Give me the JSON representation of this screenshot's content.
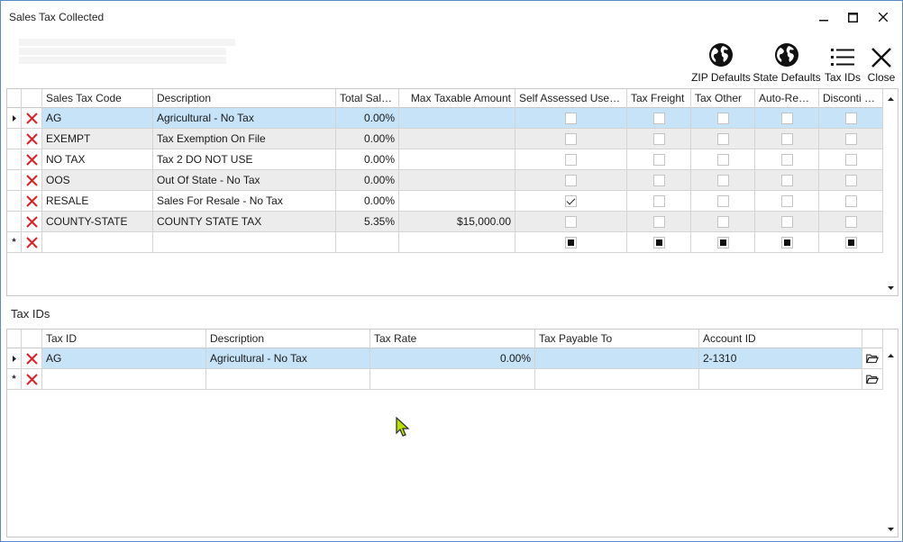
{
  "window": {
    "title": "Sales Tax Collected"
  },
  "toolbar": {
    "zip_defaults": "ZIP Defaults",
    "state_defaults": "State Defaults",
    "tax_ids": "Tax IDs",
    "close": "Close"
  },
  "grid1": {
    "headers": [
      "Sales Tax Code",
      "Description",
      "Total Sale...",
      "Max Taxable Amount",
      "Self Assessed Use Tax",
      "Tax Freight",
      "Tax Other",
      "Auto-Repl...",
      "Disconti n..."
    ],
    "rows": [
      {
        "code": "AG",
        "desc": "Agricultural - No Tax",
        "total": "0.00%",
        "max": "",
        "self": false
      },
      {
        "code": "EXEMPT",
        "desc": "Tax Exemption On File",
        "total": "0.00%",
        "max": "",
        "self": false
      },
      {
        "code": "NO TAX",
        "desc": "Tax 2 DO NOT USE",
        "total": "0.00%",
        "max": "",
        "self": false
      },
      {
        "code": "OOS",
        "desc": "Out Of State - No Tax",
        "total": "0.00%",
        "max": "",
        "self": false
      },
      {
        "code": "RESALE",
        "desc": "Sales For Resale - No Tax",
        "total": "0.00%",
        "max": "",
        "self": true
      },
      {
        "code": "COUNTY-STATE",
        "desc": "COUNTY STATE TAX",
        "total": "5.35%",
        "max": "$15,000.00",
        "self": false
      }
    ]
  },
  "section": {
    "tax_ids_label": "Tax IDs"
  },
  "grid2": {
    "headers": [
      "Tax ID",
      "Description",
      "Tax Rate",
      "Tax Payable To",
      "Account ID"
    ],
    "rows": [
      {
        "taxid": "AG",
        "desc": "Agricultural - No Tax",
        "rate": "0.00%",
        "payable": "",
        "account": "2-1310"
      }
    ]
  },
  "colors": {
    "selected_row": "#c6e3f7",
    "alt_row": "#ececec",
    "delete_x": "#e31e24",
    "cursor": "#b8e000"
  }
}
